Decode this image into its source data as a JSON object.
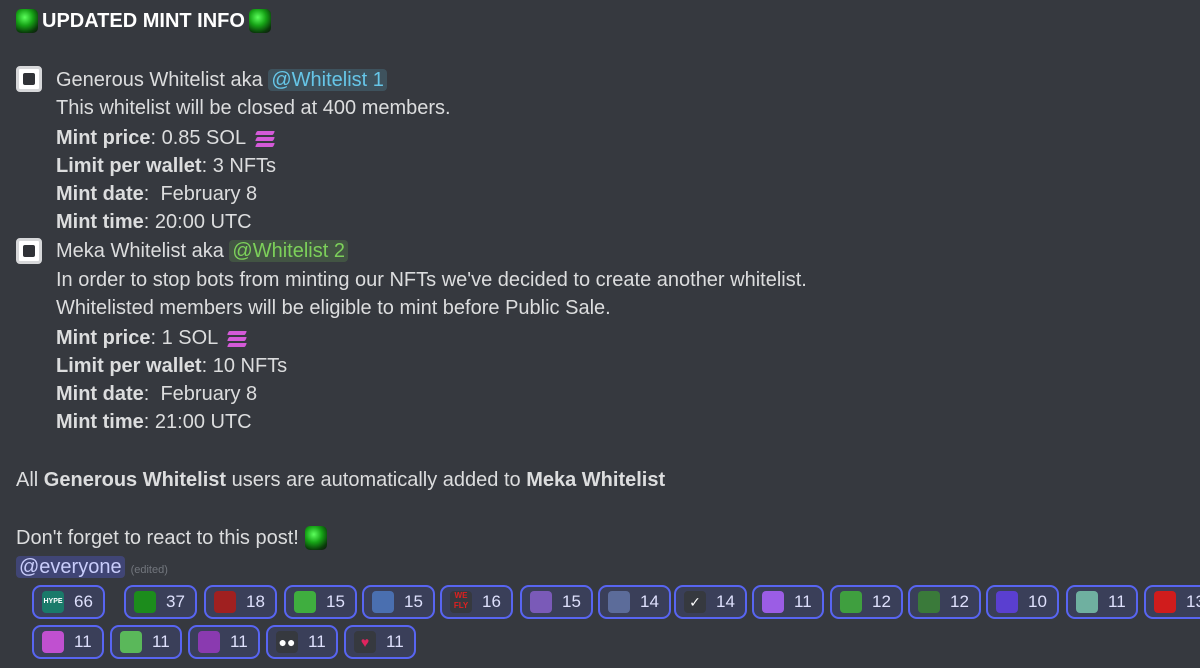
{
  "title": "UPDATED MINT INFO",
  "title_icon": "green-gem-icon",
  "sections": [
    {
      "heading_prefix": "Generous Whitelist aka",
      "mention": "@Whitelist 1",
      "desc": [
        "This whitelist will be closed at 400 members."
      ],
      "price_label": "Mint price",
      "price_value": ": 0.85 SOL",
      "limit_label": "Limit per wallet",
      "limit_value": ": 3 NFTs",
      "date_label": "Mint date",
      "date_value": ":  February 8",
      "time_label": "Mint time",
      "time_value": ": 20:00 UTC"
    },
    {
      "heading_prefix": "Meka Whitelist aka",
      "mention": "@Whitelist 2",
      "desc": [
        "In order to stop bots from minting our NFTs we've decided to create another whitelist.",
        "Whitelisted members will be eligible to mint before Public Sale."
      ],
      "price_label": "Mint price",
      "price_value": ": 1 SOL",
      "limit_label": "Limit per wallet",
      "limit_value": ": 10 NFTs",
      "date_label": "Mint date",
      "date_value": ":  February 8",
      "time_label": "Mint time",
      "time_value": ": 21:00 UTC"
    }
  ],
  "note": {
    "p1": "All ",
    "b1": "Generous Whitelist",
    "p2": " users are automatically added to ",
    "b2": "Meka Whitelist"
  },
  "react_text": "Don't forget to react to this post!",
  "everyone": "@everyone",
  "edited": "(edited)",
  "reactions": [
    {
      "emoji": "HYPE",
      "count": "66",
      "color": "#1a7a6a"
    },
    {
      "emoji": "",
      "count": "37",
      "color": "#1c8c1c"
    },
    {
      "emoji": "",
      "count": "18",
      "color": "#a02020"
    },
    {
      "emoji": "",
      "count": "15",
      "color": "#3fae3f"
    },
    {
      "emoji": "",
      "count": "15",
      "color": "#4a6fb0"
    },
    {
      "emoji": "WE FLY",
      "count": "16",
      "color": "#36393f"
    },
    {
      "emoji": "",
      "count": "15",
      "color": "#7a5ab8"
    },
    {
      "emoji": "",
      "count": "14",
      "color": "#5c6c9a"
    },
    {
      "emoji": "✓",
      "count": "14",
      "color": "#36393f"
    },
    {
      "emoji": "",
      "count": "11",
      "color": "#9b5de5"
    },
    {
      "emoji": "",
      "count": "12",
      "color": "#3f9f3f"
    },
    {
      "emoji": "",
      "count": "12",
      "color": "#3a7a3a"
    },
    {
      "emoji": "",
      "count": "10",
      "color": "#5a3fd0"
    },
    {
      "emoji": "",
      "count": "11",
      "color": "#6fb0a0"
    },
    {
      "emoji": "",
      "count": "13",
      "color": "#d01c1c"
    },
    {
      "emoji": "",
      "count": "11",
      "color": "#c050d0"
    },
    {
      "emoji": "",
      "count": "11",
      "color": "#5ab85a"
    },
    {
      "emoji": "",
      "count": "11",
      "color": "#8a3ab0"
    },
    {
      "emoji": "●●",
      "count": "11",
      "color": "#36393f"
    },
    {
      "emoji": "♥",
      "count": "11",
      "color": "#36393f"
    }
  ]
}
